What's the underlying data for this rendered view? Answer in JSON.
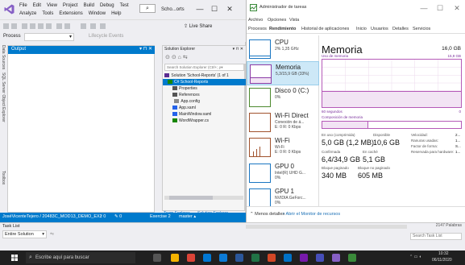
{
  "vs": {
    "menu": [
      "File",
      "Edit",
      "View",
      "Project",
      "Build",
      "Debug",
      "Test",
      "Analyze",
      "Tools",
      "Extensions",
      "Window",
      "Help"
    ],
    "search_icon": "search-icon",
    "solution_label": "Scho...orts",
    "window_controls": {
      "minimize": "—",
      "maximize": "☐",
      "close": "✕"
    },
    "live_share": "Live Share",
    "process_label": "Process",
    "lifecycle_label": "Lifecycle Events",
    "left_tabs": [
      "Data Sources",
      "SQL Server Object Explorer",
      "Toolbox"
    ],
    "output": {
      "title": "Output",
      "pin": "▾ ⊓ ✕"
    },
    "solution_explorer": {
      "title": "Solution Explorer",
      "controls": "▾ ⊓ ✕",
      "search_placeholder": "Search Solution Explorer (Ctrl+; ρ▾",
      "tree": [
        {
          "label": "Solution 'School-Reports' (1 of 1",
          "indent": 2,
          "color": "#5c2d91"
        },
        {
          "label": "C# School-Reports",
          "indent": 5,
          "color": "#178600",
          "selected": true
        },
        {
          "label": "Properties",
          "indent": 10,
          "color": "#555555"
        },
        {
          "label": "References",
          "indent": 10,
          "color": "#555555"
        },
        {
          "label": "App.config",
          "indent": 12,
          "color": "#8a8a8a"
        },
        {
          "label": "App.xaml",
          "indent": 10,
          "color": "#2563eb"
        },
        {
          "label": "MainWindow.xaml",
          "indent": 10,
          "color": "#2563eb"
        },
        {
          "label": "WordWrapper.cs",
          "indent": 10,
          "color": "#178600"
        }
      ],
      "tabs": [
        "Team Explorer",
        "Solution Explorer"
      ]
    },
    "status": {
      "branch": "JoséVicenteTejero / 20483C_MOD13_DEMO_EX2",
      "up": "↑ 0",
      "pencil": "✎ 0",
      "exercise": "Exercise 2",
      "master": "master ▴"
    },
    "tasklist": {
      "title": "Task List",
      "scope": "Entire Solution",
      "search_placeholder": "Search Task List",
      "palabras": "2147 Palabras"
    }
  },
  "taskmgr": {
    "title": "Administrador de tareas",
    "menu": [
      "Archivo",
      "Opciones",
      "Vista"
    ],
    "tabs": [
      "Procesos",
      "Rendimiento",
      "Historial de aplicaciones",
      "Inicio",
      "Usuarios",
      "Detalles",
      "Servicios"
    ],
    "active_tab": "Rendimiento",
    "resources": [
      {
        "name": "CPU",
        "sub1": "2% 1,35 GHz",
        "sub2": "",
        "color": "#1a76c2"
      },
      {
        "name": "Memoria",
        "sub1": "5,3/15,9 GB (33%)",
        "sub2": "",
        "color": "#8b3ba6",
        "active": true
      },
      {
        "name": "Disco 0 (C:)",
        "sub1": "0%",
        "sub2": "",
        "color": "#4d8a2f"
      },
      {
        "name": "Wi-Fi Direct",
        "sub1": "Conexión de á...",
        "sub2": "E: 0 R: 0 Kbps",
        "color": "#a0522d"
      },
      {
        "name": "Wi-Fi",
        "sub1": "Wi-Fi",
        "sub2": "E: 0 R: 0 Kbps",
        "color": "#a0522d"
      },
      {
        "name": "GPU 0",
        "sub1": "Intel(R) UHD G...",
        "sub2": "0%",
        "color": "#1a76c2"
      },
      {
        "name": "GPU 1",
        "sub1": "NVIDIA GeForc...",
        "sub2": "0%",
        "color": "#1a76c2"
      }
    ],
    "memory": {
      "title": "Memoria",
      "total": "16,0 GB",
      "usage_label": "Uso de memoria",
      "max_label": "15,9 GB",
      "seconds_label": "60 segundos",
      "zero_label": "0",
      "composition_label": "Composición de memoria",
      "usage_fraction": 0.33,
      "stats": {
        "en_uso_label": "En uso (comprimida)",
        "en_uso_value": "5,0 GB (1,2 MB)",
        "disponible_label": "Disponible",
        "disponible_value": "10,6 GB",
        "confirmada_label": "Confirmada",
        "confirmada_value": "6,4/34,9 GB",
        "en_cache_label": "En caché",
        "en_cache_value": "5,1 GB",
        "bloque_pag_label": "Bloque paginado",
        "bloque_pag_value": "340 MB",
        "bloque_nopag_label": "Bloque no paginado",
        "bloque_nopag_value": "605 MB"
      },
      "side": [
        {
          "label": "Velocidad:",
          "value": "2..."
        },
        {
          "label": "Ranuras usadas:",
          "value": "1..."
        },
        {
          "label": "Factor de forma:",
          "value": "S..."
        },
        {
          "label": "Reservada para hardware:",
          "value": "1..."
        }
      ]
    },
    "footer": {
      "less": "Menos detalles",
      "monitor": "Abrir el Monitor de recursos"
    },
    "window_controls": {
      "minimize": "—",
      "maximize": "☐",
      "close": "✕"
    }
  },
  "taskbar": {
    "search_placeholder": "Escribe aquí para buscar",
    "time": "10:32",
    "date": "06/11/2020"
  }
}
